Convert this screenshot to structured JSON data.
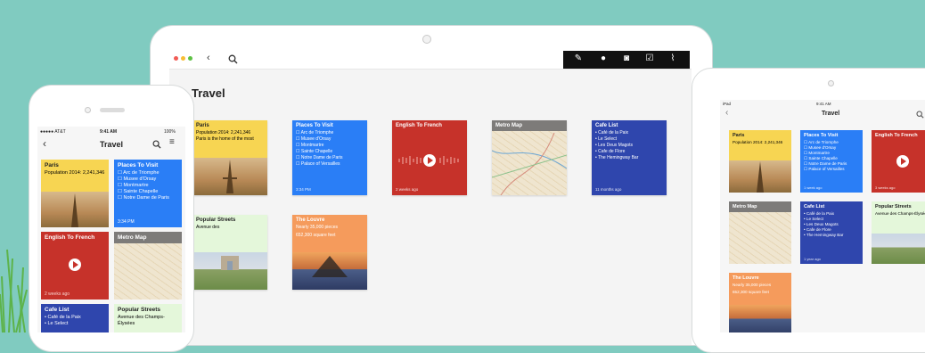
{
  "page_title": "Travel",
  "colors": {
    "background": "#80cbc0",
    "yellow_card": "#f7d552",
    "blue_card": "#2a7ef6",
    "red_card": "#c6322a",
    "navy_card": "#2f46ad",
    "mint_card": "#e4f7da",
    "orange_card": "#f59b5c",
    "gray_card": "#7d7b79"
  },
  "laptop": {
    "toolbar_icons": [
      "back-chevron-icon",
      "search-icon",
      "edit-note-icon",
      "microphone-icon",
      "camera-icon",
      "checkbox-icon",
      "paperclip-icon"
    ],
    "cards": {
      "paris": {
        "title": "Paris",
        "text": "Population 2014: 2,241,346",
        "text2": "Paris is the home of the most"
      },
      "places": {
        "title": "Places To Visit",
        "items": [
          "Arc de Triomphe",
          "Musee d'Orsay",
          "Montmartre",
          "Sainte Chapelle",
          "Notre Dame de Paris",
          "Palace of Versailles"
        ],
        "time": "3:34 PM"
      },
      "english": {
        "title": "English To French",
        "time": "2 weeks ago"
      },
      "metro": {
        "title": "Metro Map"
      },
      "cafe": {
        "title": "Cafe List",
        "items": [
          "Café de la Paix",
          "Le Select",
          "Les Deux Magots",
          "Cafe de Flore",
          "The Hemingway Bar"
        ],
        "time": "11 months ago"
      },
      "streets": {
        "title": "Popular Streets",
        "text": "Avenue des"
      },
      "louvre": {
        "title": "The Louvre",
        "text": "Nearly 35,000 pieces",
        "text2": "652,300 square feet"
      }
    }
  },
  "phone": {
    "carrier": "●●●●● AT&T",
    "time": "9:41 AM",
    "battery": "100%",
    "cards": {
      "paris": {
        "title": "Paris",
        "text": "Population 2014: 2,241,346"
      },
      "places": {
        "title": "Places To Visit",
        "items": [
          "Arc de Triomphe",
          "Musee d'Orsay",
          "Montmartre",
          "Sainte Chapelle",
          "Notre Dame de Paris"
        ],
        "time": "3:34 PM"
      },
      "english": {
        "title": "English To French",
        "time": "2 weeks ago"
      },
      "metro": {
        "title": "Metro Map"
      },
      "cafe": {
        "title": "Cafe List",
        "items": [
          "Café de la Paix",
          "Le Select"
        ]
      },
      "streets": {
        "title": "Popular Streets",
        "text": "Avenue des Champs-Élysées"
      }
    }
  },
  "tablet": {
    "carrier": "iPad",
    "time": "9:41 AM",
    "cards": {
      "paris": {
        "title": "Paris",
        "text": "Population 2014: 2,241,346"
      },
      "places": {
        "title": "Places To Visit",
        "items": [
          "Arc de Triomphe",
          "Musee d'Orsay",
          "Montmartre",
          "Sainte Chapelle",
          "Notre Dame de Paris",
          "Palace of Versailles"
        ],
        "time": "1 week ago"
      },
      "english": {
        "title": "English To French",
        "time": "3 weeks ago"
      },
      "metro": {
        "title": "Metro Map"
      },
      "cafe": {
        "title": "Cafe List",
        "items": [
          "Café de la Paix",
          "Le Select",
          "Les Deux Magots",
          "Cafe de Flore",
          "The Hemingway Bar"
        ],
        "time": "1 year ago"
      },
      "streets": {
        "title": "Popular Streets",
        "text": "Avenue des Champs-Élysées"
      },
      "louvre": {
        "title": "The Louvre",
        "text": "Nearly 35,000 pieces",
        "text2": "652,300 square feet"
      }
    }
  }
}
